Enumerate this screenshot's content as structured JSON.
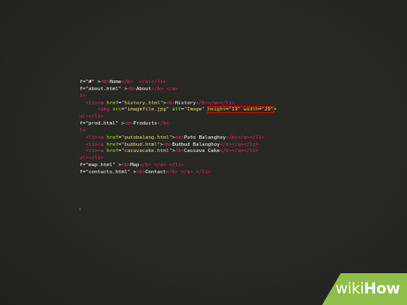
{
  "editor": {
    "lines": [
      [
        {
          "c": "tx",
          "t": "f=\"#\" >"
        },
        {
          "c": "tg",
          "t": "<b>"
        },
        {
          "c": "tx",
          "t": "Home"
        },
        {
          "c": "tg",
          "t": "</b>"
        },
        {
          "c": "tx",
          "t": "  "
        },
        {
          "c": "tg",
          "t": "</a></li>"
        }
      ],
      [
        {
          "c": "tx",
          "t": "f=\"about.html\" >"
        },
        {
          "c": "tg",
          "t": "<b>"
        },
        {
          "c": "tx",
          "t": "About"
        },
        {
          "c": "tg",
          "t": "</b>"
        },
        {
          "c": "tx",
          "t": " "
        },
        {
          "c": "tg",
          "t": "</a>"
        }
      ],
      [
        {
          "c": "tg",
          "t": "l>"
        }
      ],
      [
        {
          "c": "tx",
          "t": "  "
        },
        {
          "c": "tg",
          "t": "<li><a"
        },
        {
          "c": "tx",
          "t": " "
        },
        {
          "c": "at",
          "t": "href"
        },
        {
          "c": "tx",
          "t": "="
        },
        {
          "c": "st",
          "t": "\"history.html\""
        },
        {
          "c": "tx",
          "t": ">"
        },
        {
          "c": "tg",
          "t": "<b>"
        },
        {
          "c": "tx",
          "t": "History"
        },
        {
          "c": "tg",
          "t": "</b></a></li>"
        }
      ],
      [
        {
          "c": "tx",
          "t": "      "
        },
        {
          "c": "tg",
          "t": "<img"
        },
        {
          "c": "tx",
          "t": " "
        },
        {
          "c": "at",
          "t": "src"
        },
        {
          "c": "tx",
          "t": "="
        },
        {
          "c": "st",
          "t": "\"imagefile.jpg\""
        },
        {
          "c": "tx",
          "t": " "
        },
        {
          "c": "at",
          "t": "alt"
        },
        {
          "c": "tx",
          "t": "="
        },
        {
          "c": "st",
          "t": "\"Image\""
        },
        {
          "c": "tx",
          "t": " "
        },
        {
          "c": "at",
          "t": "height",
          "hl": "start"
        },
        {
          "c": "tx",
          "t": "="
        },
        {
          "c": "st",
          "t": "\"19\""
        },
        {
          "c": "tx",
          "t": " "
        },
        {
          "c": "at",
          "t": "width"
        },
        {
          "c": "tx",
          "t": "="
        },
        {
          "c": "st",
          "t": "\"20\"",
          "hl": "end"
        },
        {
          "c": "tx",
          "t": ">"
        }
      ],
      [
        {
          "c": "tg",
          "t": "ul></li>"
        }
      ],
      [
        {
          "c": "tx",
          "t": "f=\"prod.html\" >"
        },
        {
          "c": "tg",
          "t": "<b>"
        },
        {
          "c": "tx",
          "t": "Products"
        },
        {
          "c": "tg",
          "t": "</b>"
        }
      ],
      [
        {
          "c": "tg",
          "t": "l>"
        }
      ],
      [
        {
          "c": "tx",
          "t": "  "
        },
        {
          "c": "tg",
          "t": "<li><a"
        },
        {
          "c": "tx",
          "t": " "
        },
        {
          "c": "at",
          "t": "href"
        },
        {
          "c": "tx",
          "t": "="
        },
        {
          "c": "st",
          "t": "\"putobalang.html\""
        },
        {
          "c": "tx",
          "t": ">"
        },
        {
          "c": "tg",
          "t": "<b>"
        },
        {
          "c": "tx",
          "t": "Puto Balanghoy"
        },
        {
          "c": "tg",
          "t": "</b></a></li>"
        }
      ],
      [
        {
          "c": "tx",
          "t": "  "
        },
        {
          "c": "tg",
          "t": "<li><a"
        },
        {
          "c": "tx",
          "t": " "
        },
        {
          "c": "at",
          "t": "href"
        },
        {
          "c": "tx",
          "t": "="
        },
        {
          "c": "st",
          "t": "\"budbud.html\""
        },
        {
          "c": "tx",
          "t": ">"
        },
        {
          "c": "tg",
          "t": "<b>"
        },
        {
          "c": "tx",
          "t": "Budbud Balanghoy"
        },
        {
          "c": "tg",
          "t": "</b></a></li>"
        }
      ],
      [
        {
          "c": "tx",
          "t": "  "
        },
        {
          "c": "tg",
          "t": "<li><a"
        },
        {
          "c": "tx",
          "t": " "
        },
        {
          "c": "at",
          "t": "href"
        },
        {
          "c": "tx",
          "t": "="
        },
        {
          "c": "st",
          "t": "\"casavacake.html\""
        },
        {
          "c": "tx",
          "t": ">"
        },
        {
          "c": "tg",
          "t": "<b>"
        },
        {
          "c": "tx",
          "t": "Cassava Cake"
        },
        {
          "c": "tg",
          "t": "</b></a></li>"
        }
      ],
      [
        {
          "c": "tg",
          "t": "ul></li>"
        }
      ],
      [
        {
          "c": "tx",
          "t": "f=\"map.html\" >"
        },
        {
          "c": "tg",
          "t": "<b>"
        },
        {
          "c": "tx",
          "t": "Map"
        },
        {
          "c": "tg",
          "t": "</b>"
        },
        {
          "c": "tx",
          "t": " "
        },
        {
          "c": "tg",
          "t": "</a>"
        },
        {
          "c": "tx",
          "t": " "
        },
        {
          "c": "tg",
          "t": "</li>"
        }
      ],
      [
        {
          "c": "tx",
          "t": "f=\"contacts.html\" >"
        },
        {
          "c": "tg",
          "t": "<b>"
        },
        {
          "c": "tx",
          "t": "Contact"
        },
        {
          "c": "tg",
          "t": "</b>"
        },
        {
          "c": "tx",
          "t": " "
        },
        {
          "c": "tg",
          "t": "</a>"
        },
        {
          "c": "tx",
          "t": " "
        },
        {
          "c": "tg",
          "t": "</li>"
        }
      ]
    ]
  },
  "watermark": {
    "word1": "wiki",
    "word2": "How"
  },
  "colors": {
    "background": "#272822",
    "tag": "#f92672",
    "attribute": "#a6e22e",
    "string": "#e6db74",
    "text": "#f8f8f2",
    "highlight_box": "#e00000",
    "watermark_bg": "#8fbf4a"
  }
}
